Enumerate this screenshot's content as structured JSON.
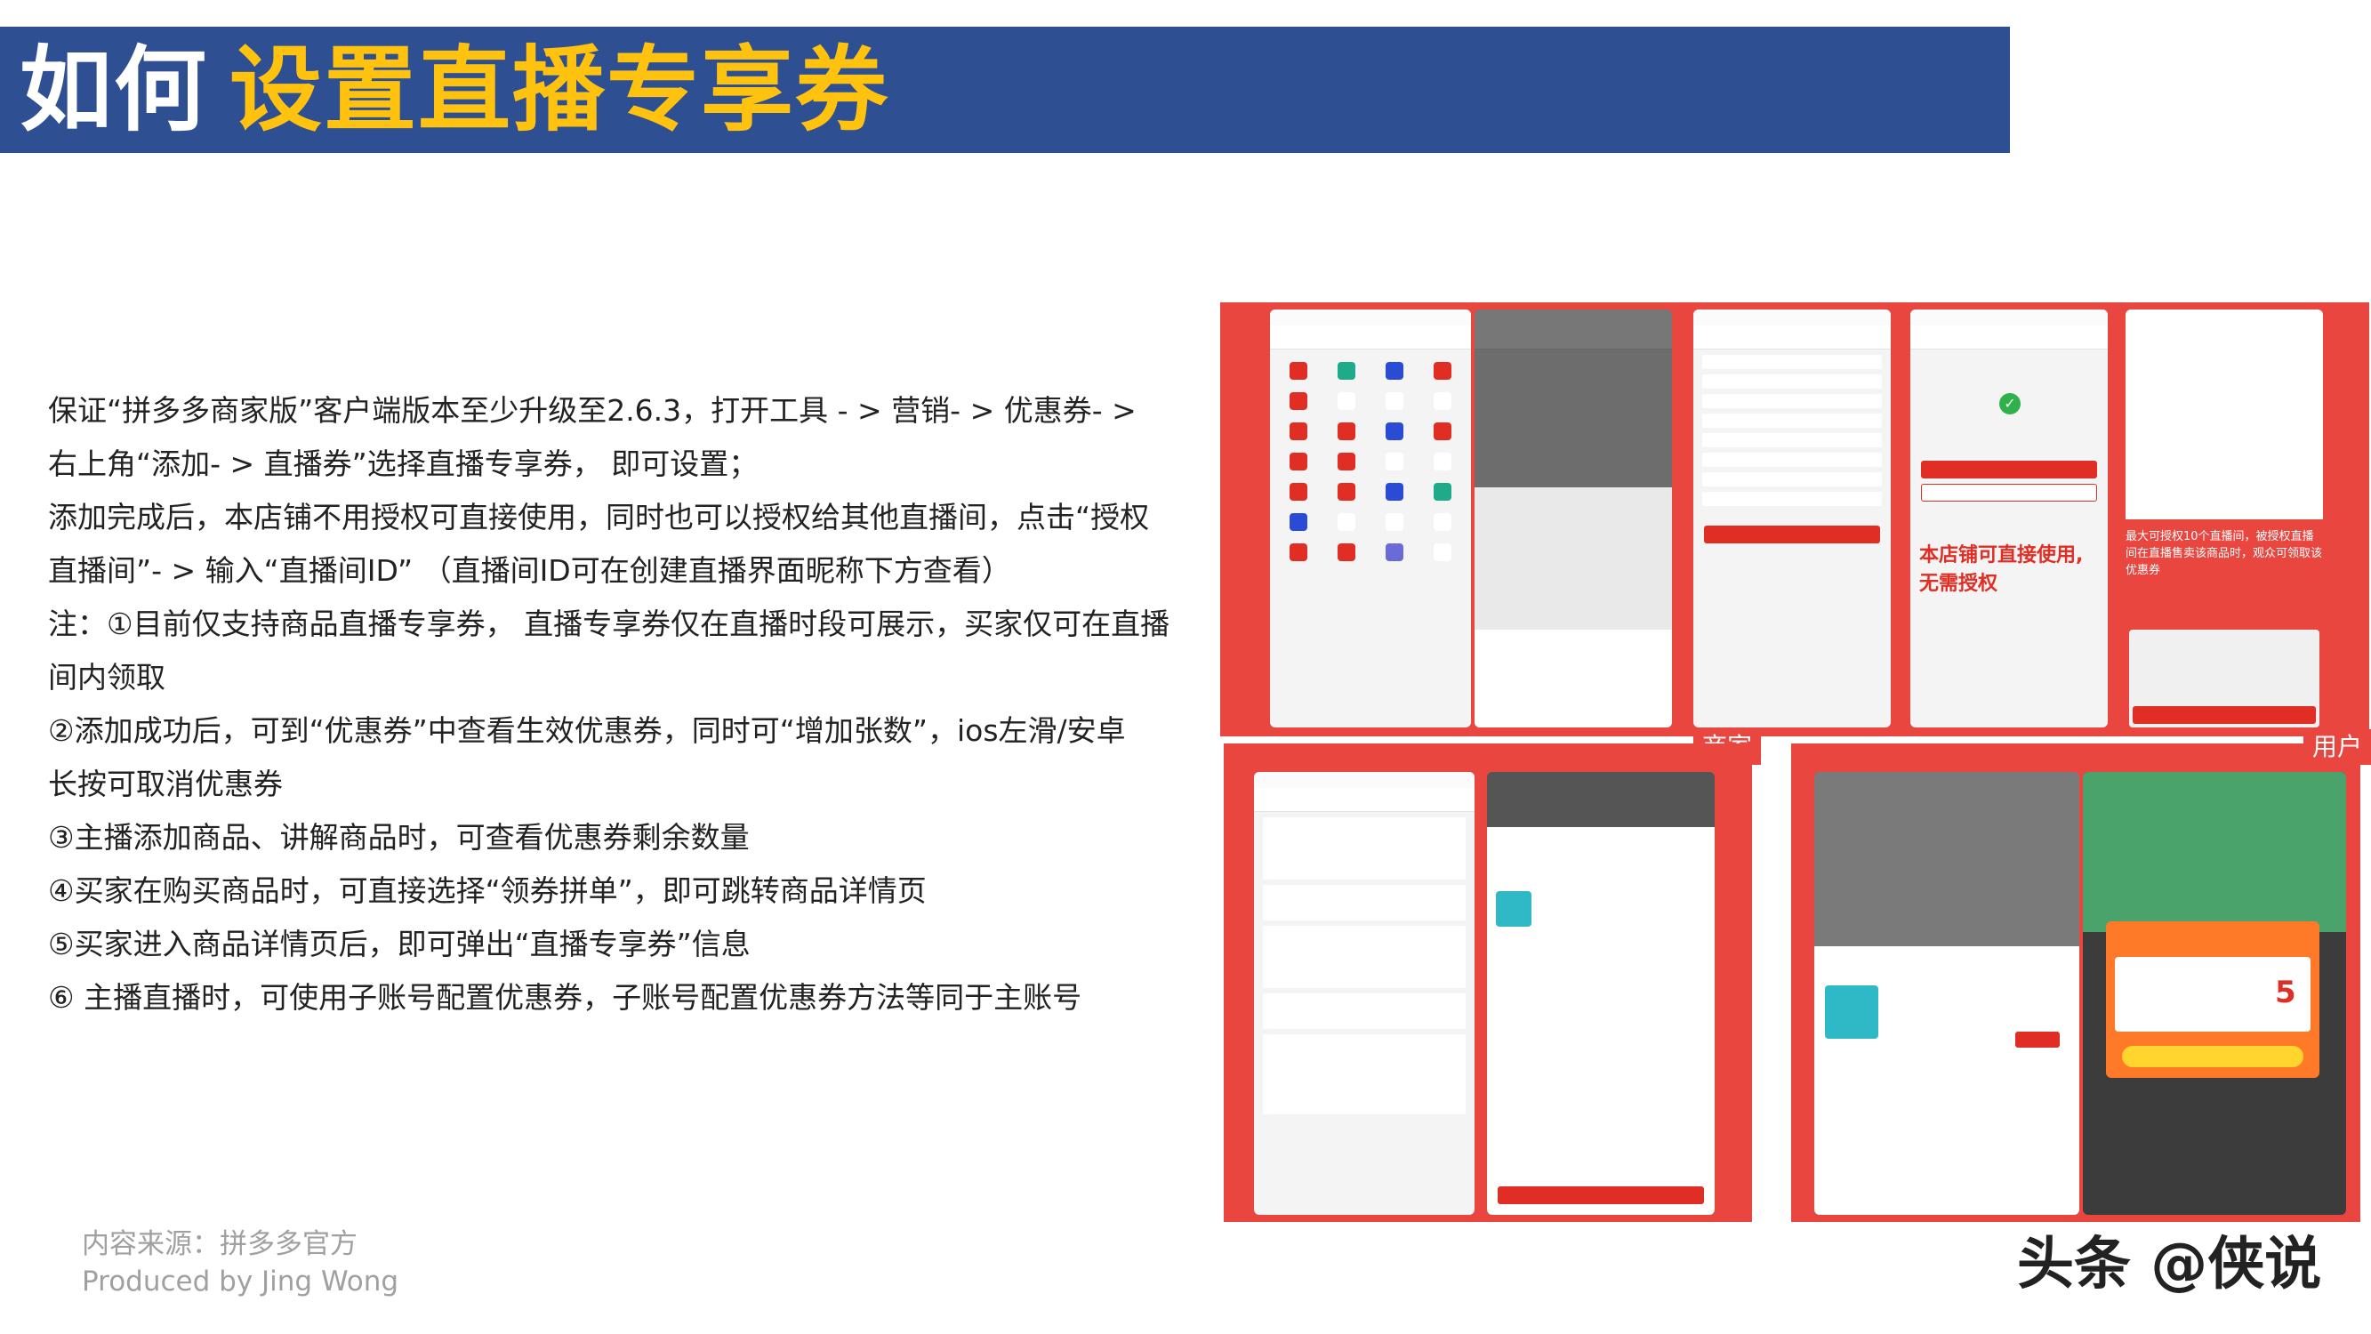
{
  "header": {
    "title_part1": "如何",
    "title_part2": "设置直播专享券"
  },
  "body": {
    "lines": [
      "保证“拼多多商家版”客户端版本至少升级至2.6.3，打开工具 - > 营销- > 优惠券- >",
      "右上角“添加- > 直播券”选择直播专享券， 即可设置；",
      "添加完成后，本店铺不用授权可直接使用，同时也可以授权给其他直播间，点击“授权",
      "直播间”- > 输入“直播间ID” （直播间ID可在创建直播界面昵称下方查看）",
      "注：①目前仅支持商品直播专享券， 直播专享券仅在直播时段可展示，买家仅可在直播",
      "间内领取",
      "②添加成功后，可到“优惠券”中查看生效优惠券，同时可“增加张数”，ios左滑/安卓",
      "长按可取消优惠券",
      "③主播添加商品、讲解商品时，可查看优惠券剩余数量",
      "④买家在购买商品时，可直接选择“领券拼单”，即可跳转商品详情页",
      "⑤买家进入商品详情页后，即可弹出“直播专享券”信息",
      "⑥ 主播直播时，可使用子账号配置优惠券，子账号配置优惠券方法等同于主账号"
    ]
  },
  "footer": {
    "source": "内容来源：拼多多官方",
    "producer": "Produced by Jing Wong"
  },
  "watermark": "头条 @侠说",
  "screenshots": {
    "tag_merchant": "商家",
    "tag_user": "用户",
    "note_direct_use": "本店铺可直接使用,",
    "note_no_auth": "无需授权",
    "note_authorize": "最大可授权10个直播间，被授权直播间在直播售卖该商品时，观众可领取该优惠券",
    "popup_price": "5"
  },
  "colors": {
    "title_bar": "#2f4f93",
    "title_accent": "#ffc20e",
    "collage_red": "#e8463f",
    "pdd_red": "#e02e24"
  }
}
